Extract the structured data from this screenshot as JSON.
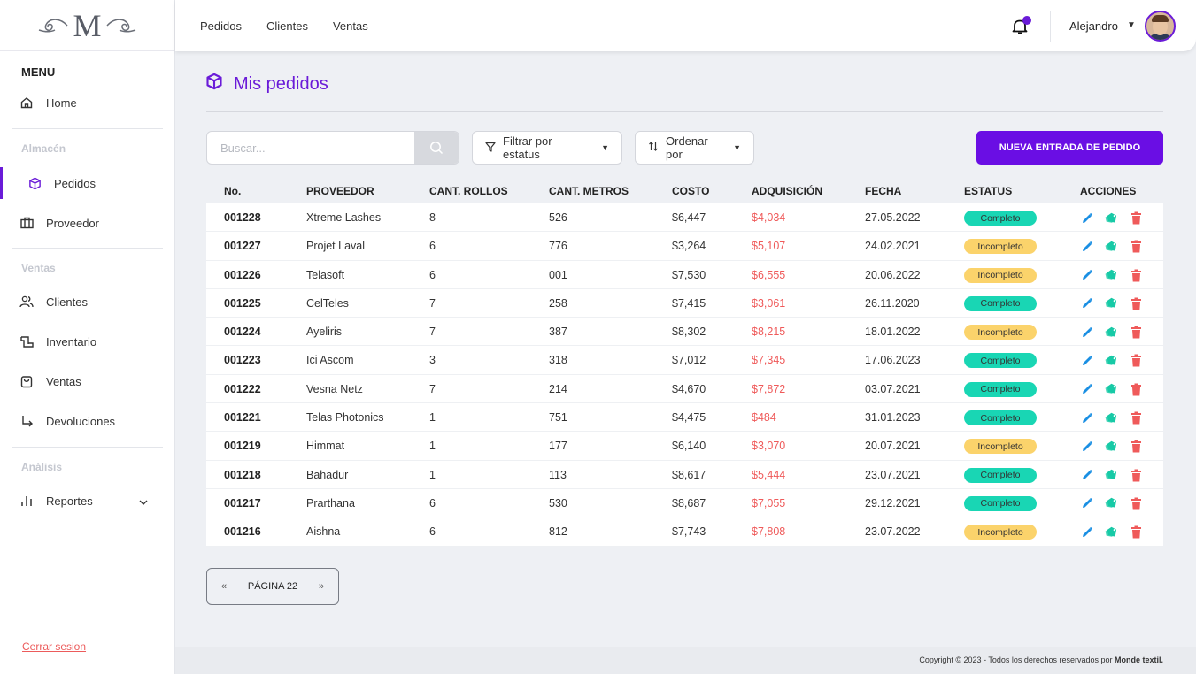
{
  "logo": {
    "letter": "M"
  },
  "sidebar": {
    "menu_heading": "MENU",
    "home": "Home",
    "section_almacen": "Almacén",
    "pedidos": "Pedidos",
    "proveedor": "Proveedor",
    "section_ventas": "Ventas",
    "clientes": "Clientes",
    "inventario": "Inventario",
    "ventas": "Ventas",
    "devoluciones": "Devoluciones",
    "section_analisis": "Análisis",
    "reportes": "Reportes",
    "logout": "Cerrar sesion"
  },
  "topbar": {
    "nav": [
      "Pedidos",
      "Clientes",
      "Ventas"
    ],
    "user_name": "Alejandro"
  },
  "page": {
    "title": "Mis pedidos",
    "search_placeholder": "Buscar...",
    "filter_label": "Filtrar por estatus",
    "sort_label": "Ordenar por",
    "new_button": "NUEVA ENTRADA DE PEDIDO"
  },
  "table": {
    "columns": [
      "No.",
      "PROVEEDOR",
      "CANT. ROLLOS",
      "CANT. METROS",
      "COSTO",
      "ADQUISICIÓN",
      "FECHA",
      "ESTATUS",
      "ACCIONES"
    ],
    "rows": [
      {
        "no": "001228",
        "proveedor": "Xtreme Lashes",
        "rollos": "8",
        "metros": "526",
        "costo": "$6,447",
        "adquisicion": "$4,034",
        "fecha": "27.05.2022",
        "estatus": "Completo"
      },
      {
        "no": "001227",
        "proveedor": "Projet Laval",
        "rollos": "6",
        "metros": "776",
        "costo": "$3,264",
        "adquisicion": "$5,107",
        "fecha": "24.02.2021",
        "estatus": "Incompleto"
      },
      {
        "no": "001226",
        "proveedor": "Telasoft",
        "rollos": "6",
        "metros": "001",
        "costo": "$7,530",
        "adquisicion": "$6,555",
        "fecha": "20.06.2022",
        "estatus": "Incompleto"
      },
      {
        "no": "001225",
        "proveedor": "CelTeles",
        "rollos": "7",
        "metros": "258",
        "costo": "$7,415",
        "adquisicion": "$3,061",
        "fecha": "26.11.2020",
        "estatus": "Completo"
      },
      {
        "no": "001224",
        "proveedor": "Ayeliris",
        "rollos": "7",
        "metros": "387",
        "costo": "$8,302",
        "adquisicion": "$8,215",
        "fecha": "18.01.2022",
        "estatus": "Incompleto"
      },
      {
        "no": "001223",
        "proveedor": "Ici Ascom",
        "rollos": "3",
        "metros": "318",
        "costo": "$7,012",
        "adquisicion": "$7,345",
        "fecha": "17.06.2023",
        "estatus": "Completo"
      },
      {
        "no": "001222",
        "proveedor": "Vesna Netz",
        "rollos": "7",
        "metros": "214",
        "costo": "$4,670",
        "adquisicion": "$7,872",
        "fecha": "03.07.2021",
        "estatus": "Completo"
      },
      {
        "no": "001221",
        "proveedor": "Telas Photonics",
        "rollos": "1",
        "metros": "751",
        "costo": "$4,475",
        "adquisicion": "$484",
        "fecha": "31.01.2023",
        "estatus": "Completo"
      },
      {
        "no": "001219",
        "proveedor": "Himmat",
        "rollos": "1",
        "metros": "177",
        "costo": "$6,140",
        "adquisicion": "$3,070",
        "fecha": "20.07.2021",
        "estatus": "Incompleto"
      },
      {
        "no": "001218",
        "proveedor": "Bahadur",
        "rollos": "1",
        "metros": "113",
        "costo": "$8,617",
        "adquisicion": "$5,444",
        "fecha": "23.07.2021",
        "estatus": "Completo"
      },
      {
        "no": "001217",
        "proveedor": "Prarthana",
        "rollos": "6",
        "metros": "530",
        "costo": "$8,687",
        "adquisicion": "$7,055",
        "fecha": "29.12.2021",
        "estatus": "Completo"
      },
      {
        "no": "001216",
        "proveedor": "Aishna",
        "rollos": "6",
        "metros": "812",
        "costo": "$7,743",
        "adquisicion": "$7,808",
        "fecha": "23.07.2022",
        "estatus": "Incompleto"
      }
    ]
  },
  "pager": {
    "prev": "«",
    "label": "PÁGINA 22",
    "next": "»"
  },
  "footer": {
    "text": "Copyright © 2023 - Todos los derechos reservados por ",
    "brand": "Monde textil."
  },
  "colors": {
    "accent": "#6a0ee4",
    "complete": "#19d6b4",
    "incomplete": "#fbd36b",
    "danger": "#ef5a5a",
    "edit": "#1a8fe3",
    "tag": "#17c9a6"
  },
  "icons": [
    "home-icon",
    "cube-icon",
    "briefcase-icon",
    "users-icon",
    "inventory-icon",
    "bag-icon",
    "return-arrow-icon",
    "bar-chart-icon",
    "bell-icon",
    "search-icon",
    "filter-icon",
    "sort-icon",
    "pencil-icon",
    "tag-icon",
    "trash-icon"
  ]
}
